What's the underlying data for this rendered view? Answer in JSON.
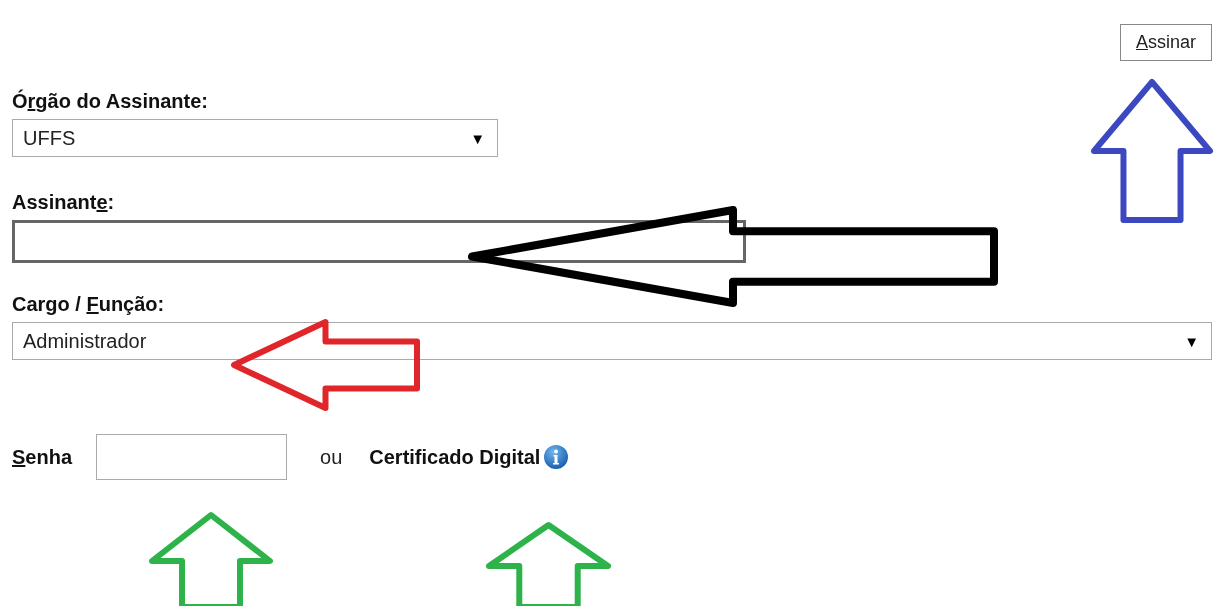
{
  "sign_button": {
    "key": "A",
    "after": "ssinar"
  },
  "organ": {
    "label": {
      "before": "Ó",
      "key": "r",
      "after": "gão do Assinante:"
    },
    "value": "UFFS",
    "arrow": "▼"
  },
  "signer": {
    "label": {
      "before": "Assinant",
      "key": "e",
      "after": ":"
    }
  },
  "role": {
    "label": {
      "before": "Cargo / ",
      "key": "F",
      "after": "unção:"
    },
    "value": "Administrador",
    "arrow": "▼"
  },
  "password": {
    "label": {
      "key": "S",
      "after": "enha"
    }
  },
  "or_text": "ou",
  "certificate": {
    "label": "Certificado Digital"
  },
  "annotations": [
    {
      "kind": "up",
      "color": "#3b48c0"
    },
    {
      "kind": "left",
      "color": "#000000"
    },
    {
      "kind": "left",
      "color": "#e0262a"
    },
    {
      "kind": "up",
      "color": "#2db34a"
    },
    {
      "kind": "up",
      "color": "#2db34a"
    }
  ]
}
